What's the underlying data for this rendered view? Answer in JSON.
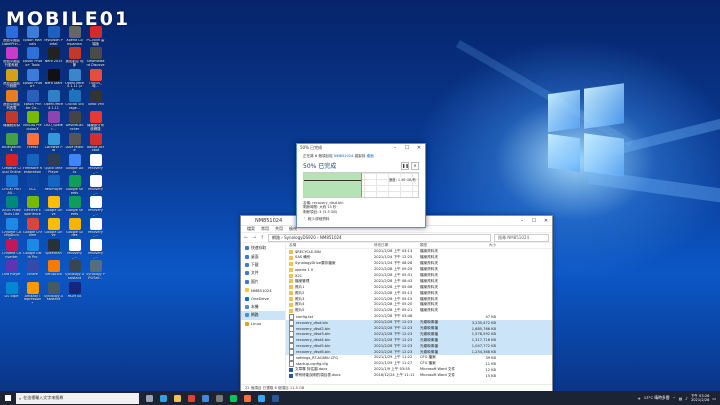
{
  "watermark": "MOBILE01",
  "desktop_icons": [
    {
      "label": "透過中國區 LabelPrin...",
      "color": "#2d6cdf"
    },
    {
      "label": "Epson Manuals",
      "color": "#3b7dd8"
    },
    {
      "label": "MyEpson Portal",
      "color": "#1f5fbf"
    },
    {
      "label": "Xperia Companion",
      "color": "#666666"
    },
    {
      "label": "PC-cillin 雲 端版",
      "color": "#d42a2a"
    },
    {
      "label": "透過中國區 行動系統",
      "color": "#c83cc8"
    },
    {
      "label": "Epson Photo+ Tools",
      "color": "#2f6fd8"
    },
    {
      "label": "Nero 2015",
      "color": "#222222"
    },
    {
      "label": "奧尼創意 環節",
      "color": "#c0392b"
    },
    {
      "label": "Smartwizard Discovery",
      "color": "#4a4a4a"
    },
    {
      "label": "透過中國區 小數鋼",
      "color": "#d4a017"
    },
    {
      "label": "Epson Photo+",
      "color": "#3d7bd9"
    },
    {
      "label": "Nero Start",
      "color": "#111111"
    },
    {
      "label": "OpenOffice 4.1.11 (zh...",
      "color": "#3a86c8"
    },
    {
      "label": "TVBOS_時...",
      "color": "#e74c3c"
    },
    {
      "label": "透過中國區 列表電",
      "color": "#e67e22"
    },
    {
      "label": "Epson Printer Co...",
      "color": "#2c5fbb"
    },
    {
      "label": "OpenOffice 4.1.11",
      "color": "#2f80c8"
    },
    {
      "label": "Crucial Storage...",
      "color": "#1c75bc"
    },
    {
      "label": "Turbo VMI",
      "color": "#333333"
    },
    {
      "label": "傳播應用錄",
      "color": "#c0392b"
    },
    {
      "label": "NVIDIA PrecisionX",
      "color": "#76b900"
    },
    {
      "label": "DSO_Spider...",
      "color": "#8e44ad"
    },
    {
      "label": "DeviceLauncher",
      "color": "#444444"
    },
    {
      "label": "傳播部分系 統網路",
      "color": "#e53935"
    },
    {
      "label": "BlueStacks 4",
      "color": "#43a047"
    },
    {
      "label": "Firefox",
      "color": "#ff7139"
    },
    {
      "label": "CBrowse Pro",
      "color": "#3498db"
    },
    {
      "label": "DAM Mobile",
      "color": "#555555"
    },
    {
      "label": "Adobe Acrobat",
      "color": "#d32f2f"
    },
    {
      "label": "Creative Cloud Online",
      "color": "#da1f26"
    },
    {
      "label": "Firmware Restoration",
      "color": "#1565c0"
    },
    {
      "label": "QuickTime Player",
      "color": "#2c3e50"
    },
    {
      "label": "Google Docs",
      "color": "#4285f4"
    },
    {
      "label": "recovery_...",
      "color": "#ffffff"
    },
    {
      "label": "CHGKI PRO AX...",
      "color": "#1976d2"
    },
    {
      "label": "GCC",
      "color": "#0d47a1"
    },
    {
      "label": "RealPlayer",
      "color": "#1565c0"
    },
    {
      "label": "Google Sheets",
      "color": "#0f9d58"
    },
    {
      "label": "recovery_...",
      "color": "#ffffff"
    },
    {
      "label": "ASUS Ruby Tools Lite",
      "color": "#00897b"
    },
    {
      "label": "GeForce Experience",
      "color": "#76b900"
    },
    {
      "label": "Google Drive",
      "color": "#fbbc05"
    },
    {
      "label": "Google Sheets",
      "color": "#0f9d58"
    },
    {
      "label": "recovery_...",
      "color": "#ffffff"
    },
    {
      "label": "Chrome ConfigDump...",
      "color": "#1e88e5"
    },
    {
      "label": "Google Chrome",
      "color": "#db4437"
    },
    {
      "label": "Google Drive",
      "color": "#fbbc05"
    },
    {
      "label": "Google Slides",
      "color": "#f4b400"
    },
    {
      "label": "recovery_...",
      "color": "#ffffff"
    },
    {
      "label": "Chrome Converter",
      "color": "#c2185b"
    },
    {
      "label": "Google Earth Pro",
      "color": "#1e88e5"
    },
    {
      "label": "SpeedFan",
      "color": "#263238"
    },
    {
      "label": "recovery_...",
      "color": "#ffffff"
    },
    {
      "label": "recovery_...",
      "color": "#ffffff"
    },
    {
      "label": "Dvd Player",
      "color": "#5e35b1"
    },
    {
      "label": "iShare",
      "color": "#3949ab"
    },
    {
      "label": "Setupcoin",
      "color": "#f57c00"
    },
    {
      "label": "Synology Assistant",
      "color": "#37474f"
    },
    {
      "label": "Synology PROSell...",
      "color": "#546e7a"
    },
    {
      "label": "DS cope",
      "color": "#0288d1"
    },
    {
      "label": "Amazon Impressions",
      "color": "#ff9800"
    },
    {
      "label": "Synology Assistant",
      "color": "#455a64"
    },
    {
      "label": "MGM 08",
      "color": "#1a237e"
    }
  ],
  "explorer": {
    "title": "NM851024",
    "tab_labels": [
      "檔案",
      "常用",
      "共用",
      "檢視"
    ],
    "breadcrumb": "網路 › SynologyDS920 › NM851024",
    "search_placeholder": "搜尋 NM851024",
    "columns": [
      "名稱",
      "修改日期",
      "類型",
      "大小"
    ],
    "nav_items": [
      {
        "label": "快速存取",
        "color": "#3a7bd5"
      },
      {
        "label": "桌面",
        "color": "#3a7bd5"
      },
      {
        "label": "下載",
        "color": "#3a7bd5"
      },
      {
        "label": "文件",
        "color": "#3a7bd5"
      },
      {
        "label": "圖片",
        "color": "#3a7bd5"
      },
      {
        "label": "NM851024",
        "color": "#f2c14e"
      },
      {
        "label": "OneDrive",
        "color": "#0a6ed1"
      },
      {
        "label": "本機",
        "color": "#4a90d9"
      },
      {
        "label": "網路",
        "color": "#4a90d9",
        "selected": true
      },
      {
        "label": "Linux",
        "color": "#e0a030"
      }
    ],
    "files": [
      {
        "name": "$RECYCLE.BIN",
        "date": "2021/2/28 上午 03:13",
        "type": "檔案資料夾",
        "size": "",
        "kind": "folder"
      },
      {
        "name": "SAS 備份",
        "date": "2021/1/24 下午 12:25",
        "type": "檔案資料夾",
        "size": "",
        "kind": "folder"
      },
      {
        "name": "SynologyDrive雲存檔案",
        "date": "2021/1/24 下午 08:28",
        "type": "檔案資料夾",
        "size": "",
        "kind": "folder"
      },
      {
        "name": "xperia 1 II",
        "date": "2021/2/28 上午 09:25",
        "type": "檔案資料夾",
        "size": "",
        "kind": "folder"
      },
      {
        "name": "X21",
        "date": "2021/2/28 上午 05:31",
        "type": "檔案資料夾",
        "size": "",
        "kind": "folder"
      },
      {
        "name": "檔案管理",
        "date": "2021/2/28 上午 08:43",
        "type": "檔案資料夾",
        "size": "",
        "kind": "folder"
      },
      {
        "name": "照片1",
        "date": "2021/2/28 上午 05:06",
        "type": "檔案資料夾",
        "size": "",
        "kind": "folder"
      },
      {
        "name": "照片2",
        "date": "2021/2/28 上午 05:13",
        "type": "檔案資料夾",
        "size": "",
        "kind": "folder"
      },
      {
        "name": "照片3",
        "date": "2021/2/28 上午 05:15",
        "type": "檔案資料夾",
        "size": "",
        "kind": "folder"
      },
      {
        "name": "照片4",
        "date": "2021/2/28 上午 05:20",
        "type": "檔案資料夾",
        "size": "",
        "kind": "folder"
      },
      {
        "name": "照片5",
        "date": "2021/2/28 上午 05:21",
        "type": "檔案資料夾",
        "size": "",
        "kind": "folder"
      },
      {
        "name": "config.txt",
        "date": "2021/2/28 下午 03:48",
        "type": "",
        "size": "47 KB",
        "kind": "file"
      },
      {
        "name": "recovery_dtsd.bin",
        "date": "2021/2/28 下午 12:23",
        "type": "光碟映像檔",
        "size": "3,235,472 KB",
        "kind": "file",
        "selected": true
      },
      {
        "name": "recovery_dtsd2.bin",
        "date": "2021/2/28 下午 12:23",
        "type": "光碟映像檔",
        "size": "1,685,766 KB",
        "kind": "file",
        "selected": true
      },
      {
        "name": "recovery_dtsd3.bin",
        "date": "2021/2/28 下午 12:23",
        "type": "光碟映像檔",
        "size": "1,578,592 KB",
        "kind": "file",
        "selected": true
      },
      {
        "name": "recovery_dtsd4.bin",
        "date": "2021/2/28 下午 12:23",
        "type": "光碟映像檔",
        "size": "1,317,716 KB",
        "kind": "file",
        "selected": true
      },
      {
        "name": "recovery_dtsd5.bin",
        "date": "2021/2/28 下午 12:23",
        "type": "光碟映像檔",
        "size": "1,047,772 KB",
        "kind": "file",
        "selected": true
      },
      {
        "name": "recovery_dtsd6.bin",
        "date": "2021/2/28 下午 12:23",
        "type": "光碟映像檔",
        "size": "1,254,368 KB",
        "kind": "file",
        "selected": true
      },
      {
        "name": "settings_RT-AC86U.CFG",
        "date": "2021/1/29 上午 11:22",
        "type": "CFG 檔案",
        "size": "39 KB",
        "kind": "file"
      },
      {
        "name": "startup-config.cfg",
        "date": "2021/1/29 上午 11:27",
        "type": "CFG 檔案",
        "size": "11 KB",
        "kind": "file"
      },
      {
        "name": "文章專 評估圖.docx",
        "date": "2021/1/9 上午 03:55",
        "type": "Microsoft Word 文件",
        "size": "12 KB",
        "kind": "doc"
      },
      {
        "name": "帶有修能說明的項目表.docx",
        "date": "2016/12/24 上午 11:11",
        "type": "Microsoft Word 文件",
        "size": "15 KB",
        "kind": "doc"
      }
    ],
    "status": "22 個項目   已選取 6 個項目  11.5 GB"
  },
  "copy_dialog": {
    "title": "50% 已完成",
    "description_prefix": "正在將 6 個項目從",
    "source": "NM851024",
    "description_mid": "複製到",
    "destination": "桌面",
    "percent_text": "50% 已完成",
    "progress_fraction": 0.5,
    "speed": "速度: 1.56 GB/秒",
    "name_line": "名稱: recovery_dtsd.bin",
    "time_line": "剩餘時間: 大約 15 秒",
    "items_line": "剩餘項目: 4 (3.3 GB)",
    "less_details": "較少詳細資料",
    "pause_icon": "pause-icon",
    "close_icon": "close-icon"
  },
  "taskbar": {
    "search_placeholder": "在這裡輸入文字來搜尋",
    "apps": [
      {
        "name": "task-view",
        "color": "#9aa4b8"
      },
      {
        "name": "edge",
        "color": "#2ea3e3"
      },
      {
        "name": "explorer",
        "color": "#f2c14e"
      },
      {
        "name": "chrome",
        "color": "#db4437"
      },
      {
        "name": "mail",
        "color": "#3f8ae0"
      },
      {
        "name": "store",
        "color": "#7a7a7a"
      },
      {
        "name": "line",
        "color": "#06c755"
      },
      {
        "name": "firefox",
        "color": "#ff7139"
      },
      {
        "name": "photoshop",
        "color": "#31a8ff"
      },
      {
        "name": "word",
        "color": "#2b579a"
      }
    ],
    "weather": "13°C 晴時多雲",
    "time": "下午 03:26",
    "date": "2021/2/28"
  }
}
